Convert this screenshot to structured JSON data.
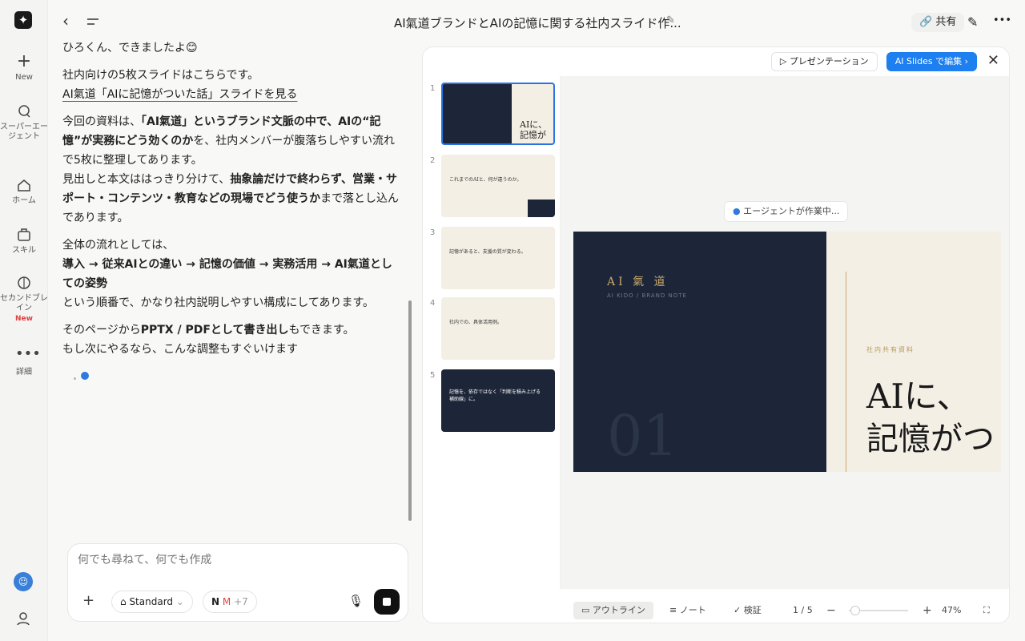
{
  "sidebar": {
    "items": [
      {
        "label": "New",
        "icon": "plus-icon"
      },
      {
        "label": "スーパーエージェント",
        "icon": "agent-icon"
      },
      {
        "label": "ホーム",
        "icon": "home-icon"
      },
      {
        "label": "スキル",
        "icon": "skill-icon"
      },
      {
        "label": "セカンドブレイン",
        "icon": "brain-icon",
        "badge": "New"
      },
      {
        "label": "詳細",
        "icon": "more-icon"
      }
    ]
  },
  "header": {
    "title": "AI氣道ブランドとAIの記憶に関する社内スライド作...",
    "share": "共有"
  },
  "chat": {
    "partial": "ひろくん、できましたよ😊",
    "p1": "社内向けの5枚スライドはこちらです。",
    "link": "AI氣道「AIに記憶がついた話」スライドを見る",
    "p2a": "今回の資料は、",
    "p2b": "「AI氣道」というブランド文脈の中で、AIの“記憶”が実務にどう効くのか",
    "p2c": "を、社内メンバーが腹落ちしやすい流れで5枚に整理してあります。",
    "p3a": "見出しと本文ははっきり分けて、",
    "p3b": "抽象論だけで終わらず、営業・サポート・コンテンツ・教育などの現場でどう使うか",
    "p3c": "まで落とし込んであります。",
    "p4a": "全体の流れとしては、",
    "p4b": "導入 → 従来AIとの違い → 記憶の価値 → 実務活用 → AI氣道としての姿勢",
    "p4c": "という順番で、かなり社内説明しやすい構成にしてあります。",
    "p5a": "そのページから",
    "p5b": "PPTX / PDFとして書き出し",
    "p5c": "もできます。",
    "p6": "もし次にやるなら、こんな調整もすぐいけます"
  },
  "composer": {
    "placeholder": "何でも尋ねて、何でも作成",
    "mode": "Standard",
    "more": "+7"
  },
  "panel": {
    "present": "プレゼンテーション",
    "edit": "AI Slides で編集 ›",
    "agent": "エージェントが作業中...",
    "thumbs": [
      {
        "n": "1",
        "title": "AIに、記憶が"
      },
      {
        "n": "2",
        "title": "これまでのAIと、何が違うのか。"
      },
      {
        "n": "3",
        "title": "記憶があると、支援の質が変わる。"
      },
      {
        "n": "4",
        "title": "社内での、具体活用例。"
      },
      {
        "n": "5",
        "title": "記憶を、依存ではなく「判断を積み上げる補助線」に。"
      }
    ],
    "slide": {
      "brand": "AI 氣 道",
      "sub": "AI KIDO / BRAND NOTE",
      "num": "01",
      "tag": "社内共有資料",
      "line1": "AIに、",
      "line2": "記憶がつ"
    },
    "bottom": {
      "outline": "アウトライン",
      "note": "ノート",
      "verify": "検証",
      "page": "1 / 5",
      "zoom": "47%"
    }
  }
}
